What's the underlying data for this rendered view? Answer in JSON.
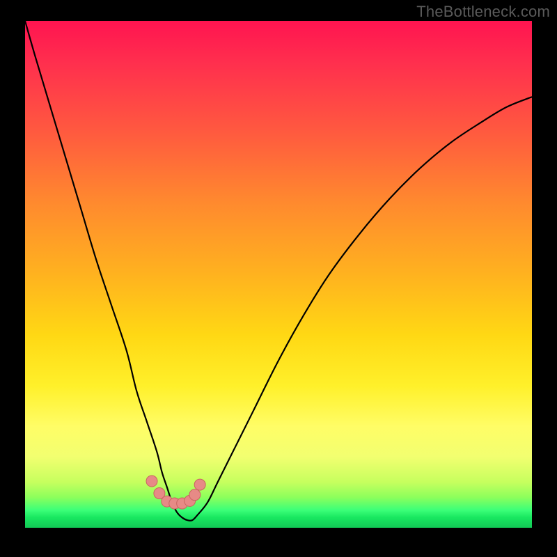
{
  "watermark": "TheBottleneck.com",
  "colors": {
    "frame": "#000000",
    "curve": "#000000",
    "marker_fill": "#e78a86",
    "marker_stroke": "#c96560",
    "watermark": "#5a5a5a"
  },
  "chart_data": {
    "type": "line",
    "title": "",
    "xlabel": "",
    "ylabel": "",
    "xlim": [
      0,
      100
    ],
    "ylim": [
      0,
      100
    ],
    "x": [
      0,
      2,
      5,
      8,
      11,
      14,
      17,
      20,
      22,
      24,
      26,
      27,
      28,
      29,
      30,
      31,
      32,
      33,
      34,
      36,
      38,
      41,
      45,
      50,
      55,
      60,
      66,
      72,
      78,
      84,
      90,
      95,
      100
    ],
    "values": [
      100,
      93,
      83,
      73,
      63,
      53,
      44,
      35,
      27,
      21,
      15,
      11,
      8,
      5,
      3,
      2,
      1.5,
      1.5,
      2.5,
      5,
      9,
      15,
      23,
      33,
      42,
      50,
      58,
      65,
      71,
      76,
      80,
      83,
      85
    ],
    "markers": {
      "x": [
        25,
        26.5,
        28,
        29.5,
        31,
        32.5,
        33.5,
        34.5
      ],
      "y": [
        9.2,
        6.8,
        5.2,
        4.8,
        4.8,
        5.3,
        6.5,
        8.5
      ]
    },
    "background_gradient": "red-yellow-green (top to bottom)",
    "note": "Axes in abstract 0-100 units; no tick labels visible."
  }
}
